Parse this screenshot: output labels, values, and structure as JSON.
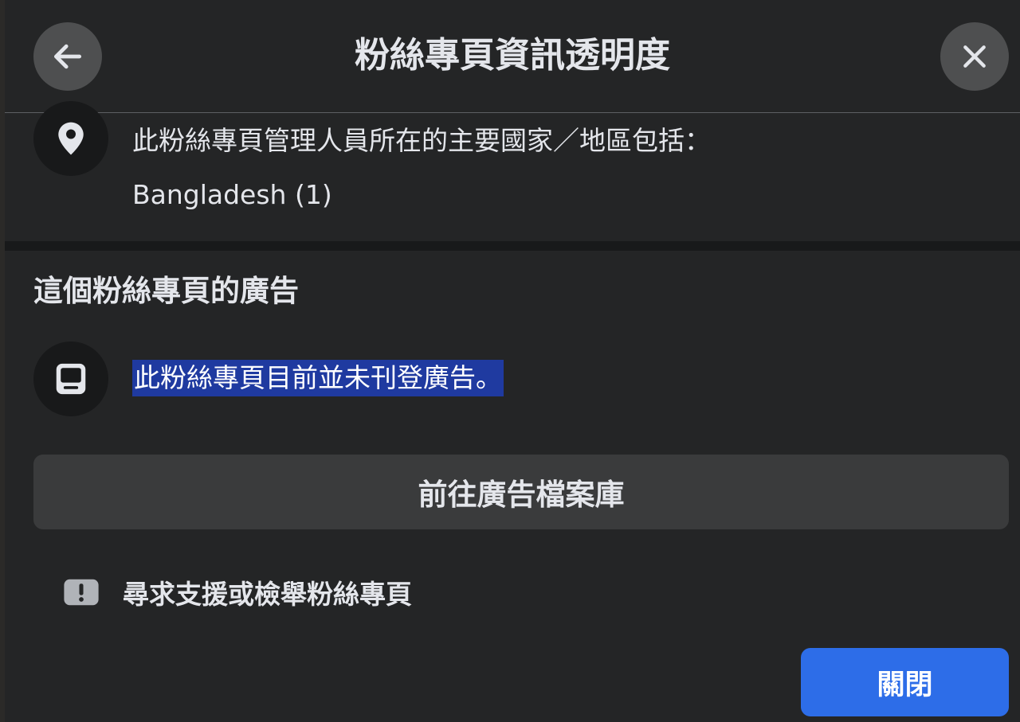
{
  "dialog": {
    "title": "粉絲專頁資訊透明度"
  },
  "location": {
    "label": "此粉絲專頁管理人員所在的主要國家／地區包括：",
    "value": "Bangladesh (1)"
  },
  "ads": {
    "heading": "這個粉絲專頁的廣告",
    "status_text": "此粉絲專頁目前並未刊登廣告。",
    "library_button": "前往廣告檔案庫"
  },
  "report": {
    "label": "尋求支援或檢舉粉絲專頁"
  },
  "footer": {
    "close_button": "關閉"
  },
  "colors": {
    "dialog_bg": "#242526",
    "primary_button": "#2d6de8",
    "secondary_button": "#3a3b3c",
    "text": "#e4e6eb",
    "selection": "#1f3aa0"
  },
  "icons": {
    "back": "arrow-left-icon",
    "close": "close-icon",
    "location": "location-pin-icon",
    "ads": "ad-monitor-icon",
    "report": "exclamation-icon"
  }
}
